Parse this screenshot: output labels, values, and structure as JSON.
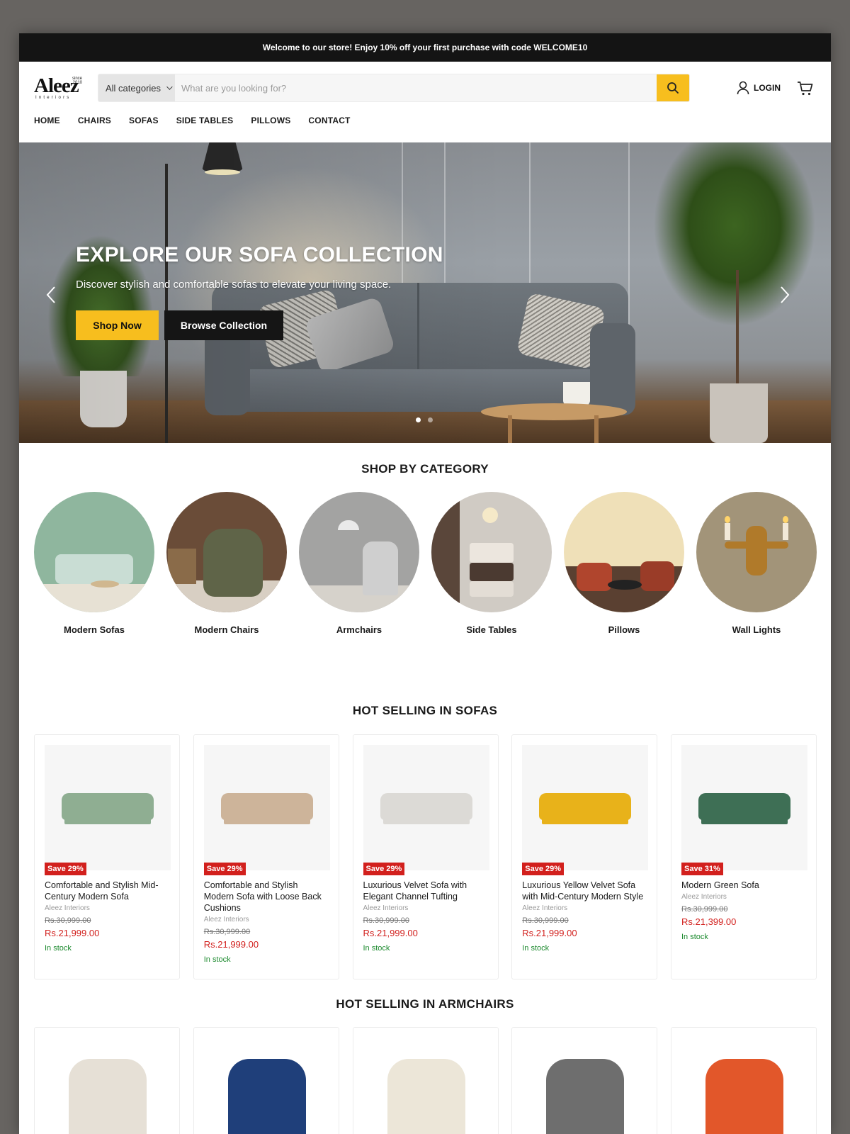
{
  "announcement": "Welcome to our store! Enjoy 10% off your first purchase with code WELCOME10",
  "brand": {
    "name": "Aleez",
    "tagline": "Interiors",
    "since_label": "since",
    "since_year": "2010"
  },
  "search": {
    "category": "All categories",
    "placeholder": "What are you looking for?"
  },
  "header": {
    "login": "LOGIN"
  },
  "nav": [
    "HOME",
    "CHAIRS",
    "SOFAS",
    "SIDE TABLES",
    "PILLOWS",
    "CONTACT"
  ],
  "hero": {
    "title": "EXPLORE OUR SOFA COLLECTION",
    "subtitle": "Discover stylish and comfortable sofas to elevate your living space.",
    "primary_cta": "Shop Now",
    "secondary_cta": "Browse Collection",
    "slide_count": 2,
    "active_slide": 1
  },
  "categories": {
    "title": "SHOP BY CATEGORY",
    "items": [
      "Modern Sofas",
      "Modern Chairs",
      "Armchairs",
      "Side Tables",
      "Pillows",
      "Wall Lights"
    ]
  },
  "sofas": {
    "title": "HOT SELLING IN SOFAS",
    "products": [
      {
        "badge": "Save 29%",
        "title": "Comfortable and Stylish Mid-Century Modern Sofa",
        "vendor": "Aleez Interiors",
        "old_price": "Rs.30,999.00",
        "price": "Rs.21,999.00",
        "stock": "In stock",
        "color": "#8fae92"
      },
      {
        "badge": "Save 29%",
        "title": "Comfortable and Stylish Modern Sofa with Loose Back Cushions",
        "vendor": "Aleez Interiors",
        "old_price": "Rs.30,999.00",
        "price": "Rs.21,999.00",
        "stock": "In stock",
        "color": "#cdb49a"
      },
      {
        "badge": "Save 29%",
        "title": "Luxurious Velvet Sofa with Elegant Channel Tufting",
        "vendor": "Aleez Interiors",
        "old_price": "Rs.30,999.00",
        "price": "Rs.21,999.00",
        "stock": "In stock",
        "color": "#dcdad6"
      },
      {
        "badge": "Save 29%",
        "title": "Luxurious Yellow Velvet Sofa with Mid-Century Modern Style",
        "vendor": "Aleez Interiors",
        "old_price": "Rs.30,999.00",
        "price": "Rs.21,999.00",
        "stock": "In stock",
        "color": "#e8b21a"
      },
      {
        "badge": "Save 31%",
        "title": "Modern Green Sofa",
        "vendor": "Aleez Interiors",
        "old_price": "Rs.30,999.00",
        "price": "Rs.21,399.00",
        "stock": "In stock",
        "color": "#3e6f55"
      }
    ]
  },
  "armchairs": {
    "title": "HOT SELLING IN ARMCHAIRS",
    "colors": [
      "#e6e0d6",
      "#1f3f7a",
      "#ece6d8",
      "#6e6e6e",
      "#e2572a"
    ]
  },
  "colors": {
    "accent": "#f7be1e",
    "sale": "#d2201d",
    "stock": "#1c8a2e",
    "dark": "#141414"
  }
}
